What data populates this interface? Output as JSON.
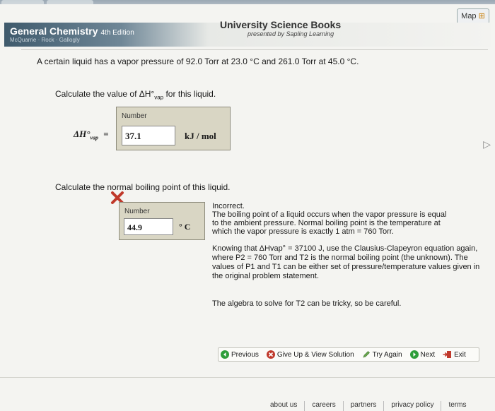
{
  "header": {
    "book_title": "General Chemistry",
    "edition": "4th Edition",
    "authors": "McQuarrie · Rock · Gallogly",
    "publisher": "University Science Books",
    "publisher_sub": "presented by Sapling Learning",
    "map_label": "Map"
  },
  "question": {
    "text": "A certain liquid has a vapor pressure of 92.0 Torr at 23.0 °C and 261.0 Torr at 45.0 °C."
  },
  "part1": {
    "prompt_before": "Calculate the value of ΔH°",
    "prompt_sub": "vap",
    "prompt_after": " for this liquid.",
    "label": "Number",
    "symbol": "ΔH°",
    "symbol_sub": "vap",
    "equals": "=",
    "value": "37.1",
    "unit": "kJ / mol"
  },
  "part2": {
    "prompt": "Calculate the normal boiling point of this liquid.",
    "label": "Number",
    "value": "44.9",
    "unit": "° C"
  },
  "feedback": {
    "status": "Incorrect.",
    "line1": "The boiling point of a liquid occurs when the vapor pressure is equal",
    "line2": "to the ambient pressure. Normal boiling point is the temperature at",
    "line3": "which the vapor pressure is exactly 1 atm = 760 Torr.",
    "hint1": "Knowing that ΔHvap° = 37100 J, use the Clausius-Clapeyron equation again, where P2 = 760 Torr and T2 is the normal boiling point (the unknown). The values of P1 and T1 can be either set of pressure/temperature values given in the original problem statement.",
    "hint2": "The algebra to solve for T2 can be tricky, so be careful."
  },
  "nav": {
    "previous": "Previous",
    "give_up": "Give Up & View Solution",
    "try_again": "Try Again",
    "next": "Next",
    "exit": "Exit"
  },
  "footer": {
    "about": "about us",
    "careers": "careers",
    "partners": "partners",
    "privacy": "privacy policy",
    "terms": "terms"
  },
  "colors": {
    "header_dark": "#3f5a6c",
    "answer_box": "#d9d6c4",
    "incorrect_red": "#c0392b",
    "nav_green": "#2e9e3a"
  }
}
